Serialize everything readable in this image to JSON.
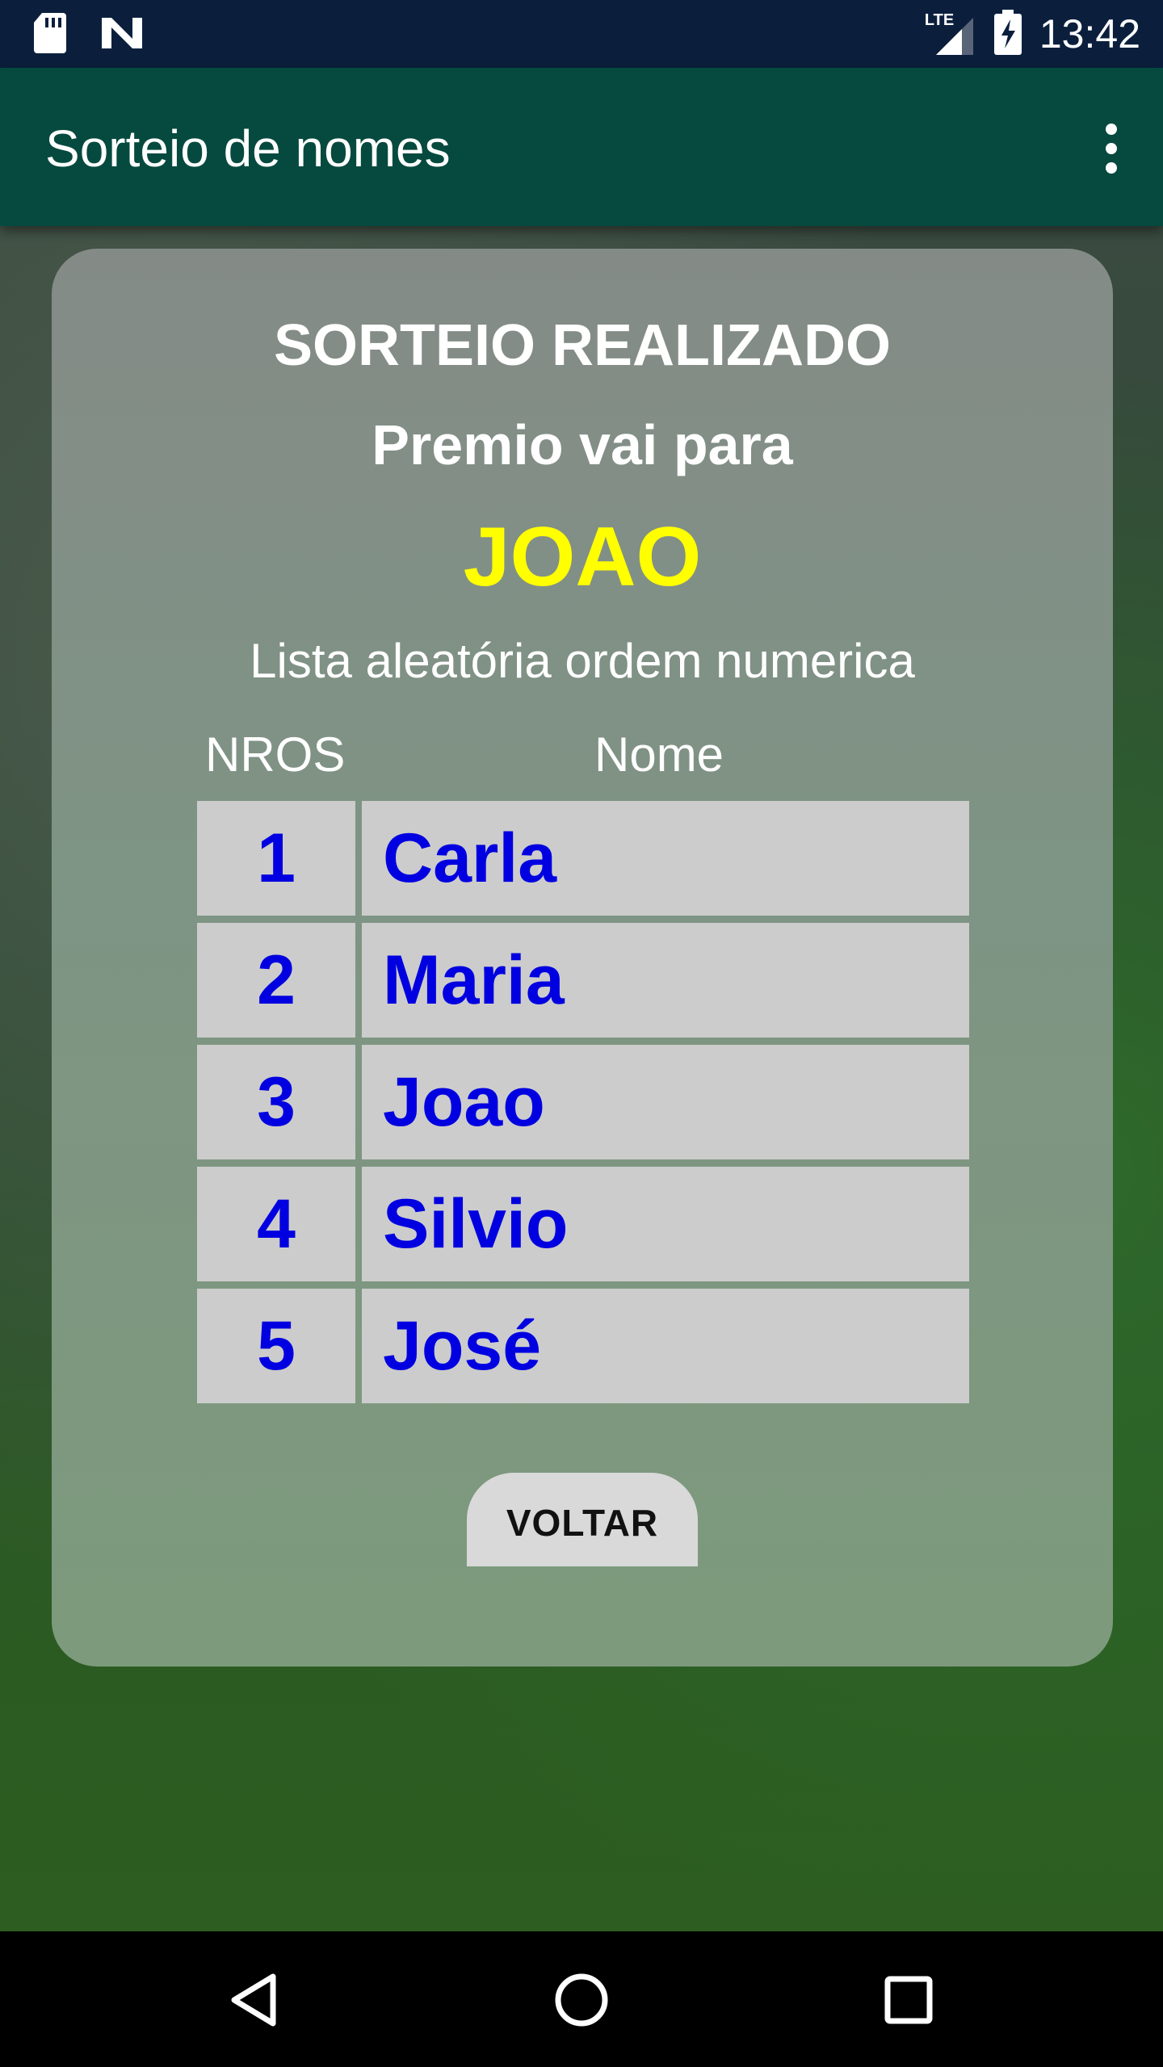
{
  "status_bar": {
    "time": "13:42",
    "network_label": "LTE",
    "icons": [
      "sd-card-icon",
      "n-logo-icon",
      "signal-icon",
      "battery-charging-icon"
    ]
  },
  "app_bar": {
    "title": "Sorteio de nomes",
    "menu_icon": "overflow-menu-icon"
  },
  "result": {
    "title": "SORTEIO REALIZADO",
    "subtitle": "Premio vai para",
    "winner": "JOAO",
    "list_caption": "Lista aleatória ordem numerica",
    "columns": {
      "number": "NROS",
      "name": "Nome"
    },
    "rows": [
      {
        "number": "1",
        "name": "Carla"
      },
      {
        "number": "2",
        "name": "Maria"
      },
      {
        "number": "3",
        "name": "Joao"
      },
      {
        "number": "4",
        "name": "Silvio"
      },
      {
        "number": "5",
        "name": "José"
      }
    ],
    "back_label": "VOLTAR"
  },
  "colors": {
    "status_bar": "#0b1f3d",
    "app_bar": "#064a3f",
    "winner": "#ffff00",
    "table_text": "#0000e0",
    "table_cell": "#cccccc"
  },
  "nav_bar": {
    "icons": [
      "back-icon",
      "home-icon",
      "recents-icon"
    ]
  }
}
